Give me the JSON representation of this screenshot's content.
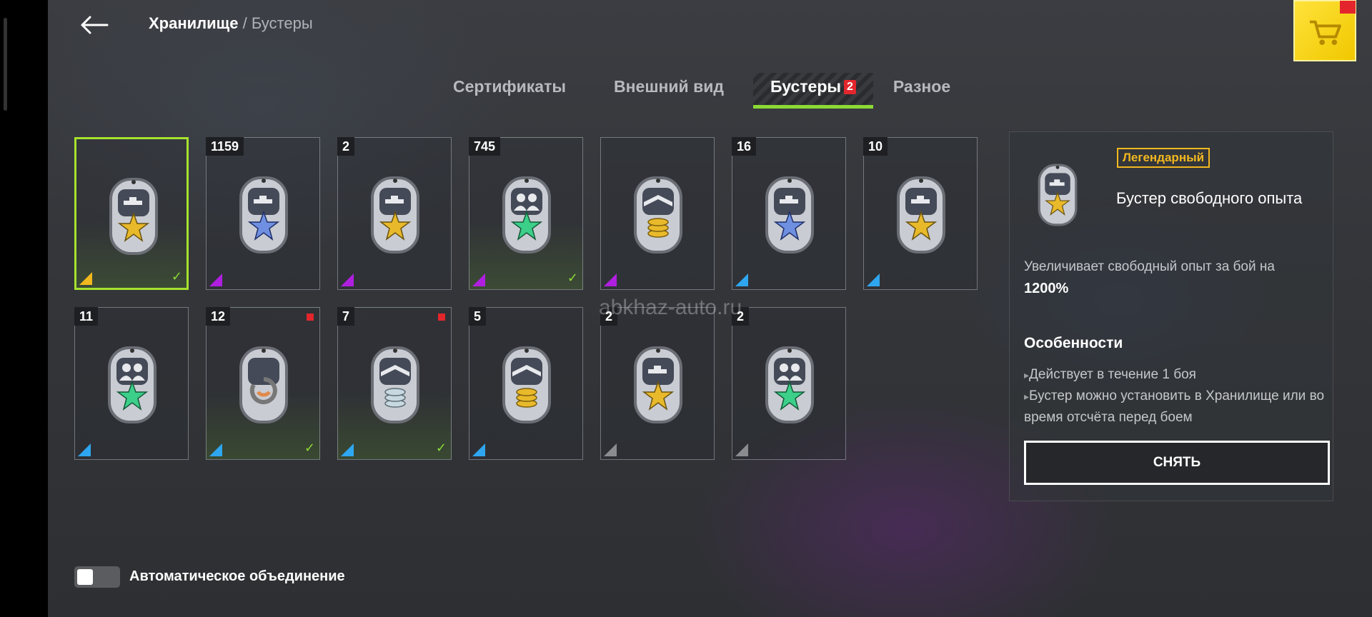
{
  "breadcrumb": {
    "root": "Хранилище",
    "separator": " / ",
    "current": "Бустеры"
  },
  "tabs": [
    {
      "label": "Сертификаты"
    },
    {
      "label": "Внешний вид"
    },
    {
      "label": "Бустеры",
      "badge": "2"
    },
    {
      "label": "Разное"
    }
  ],
  "colors": {
    "accent": "#a6e22e",
    "legendary": "#f2b81f",
    "epic": "#b01fe0",
    "rare": "#2ea6f0",
    "common": "#8a8c90",
    "new": "#e3262c"
  },
  "cards": [
    {
      "count": "",
      "rarity": "legendary",
      "icon": "tank-star-gold",
      "checked": true,
      "new": false,
      "selected": true
    },
    {
      "count": "1159",
      "rarity": "epic",
      "icon": "tank-star-blue",
      "checked": false,
      "new": false
    },
    {
      "count": "2",
      "rarity": "epic",
      "icon": "tank-star-gold",
      "checked": false,
      "new": false
    },
    {
      "count": "745",
      "rarity": "epic",
      "icon": "crew-star-green",
      "checked": true,
      "new": false
    },
    {
      "count": "",
      "rarity": "epic",
      "icon": "credits-gold",
      "checked": false,
      "new": false
    },
    {
      "count": "16",
      "rarity": "rare",
      "icon": "tank-star-blue",
      "checked": false,
      "new": false
    },
    {
      "count": "10",
      "rarity": "rare",
      "icon": "tank-star-gold",
      "checked": false,
      "new": false
    },
    {
      "count": "11",
      "rarity": "rare",
      "icon": "crew-star-green",
      "checked": false,
      "new": false
    },
    {
      "count": "12",
      "rarity": "rare",
      "icon": "repair-orange",
      "checked": true,
      "new": true
    },
    {
      "count": "7",
      "rarity": "rare",
      "icon": "credits-silver",
      "checked": true,
      "new": true
    },
    {
      "count": "5",
      "rarity": "rare",
      "icon": "credits-gold",
      "checked": false,
      "new": false
    },
    {
      "count": "2",
      "rarity": "common",
      "icon": "tank-star-gold",
      "checked": false,
      "new": false
    },
    {
      "count": "2",
      "rarity": "common",
      "icon": "crew-star-green",
      "checked": false,
      "new": false
    }
  ],
  "details": {
    "rarity_label": "Легендарный",
    "name": "Бустер свободного опыта",
    "description": "Увеличивает свободный опыт за бой на",
    "value": "1200%",
    "features_title": "Особенности",
    "features": [
      "Действует в течение 1 боя",
      "Бустер можно установить в Хранилище или во время отсчёта перед боем"
    ],
    "button_label": "СНЯТЬ"
  },
  "auto_merge": {
    "label": "Автоматическое объединение",
    "enabled": false
  },
  "watermark": "abkhaz-auto.ru"
}
